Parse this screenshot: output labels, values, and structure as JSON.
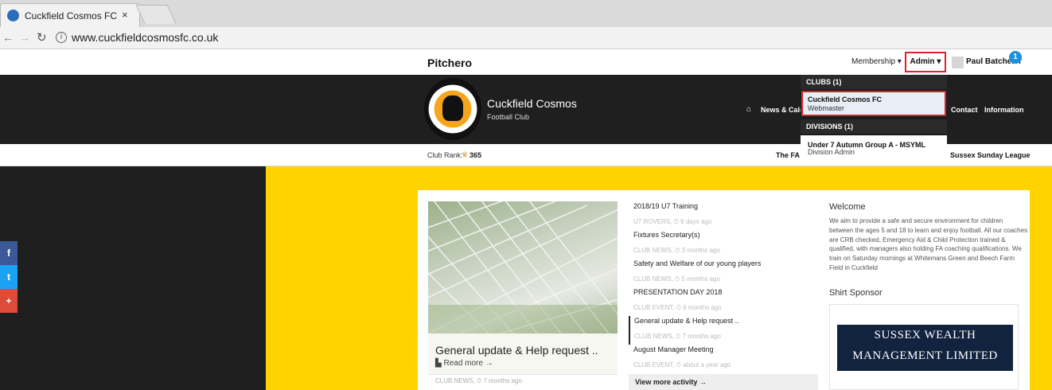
{
  "browser": {
    "tab_title": "Cuckfield Cosmos FC",
    "tab_close": "×",
    "url": "www.cuckfieldcosmosfc.co.uk"
  },
  "topbar": {
    "logo": "Pitchero",
    "membership": "Membership ▾",
    "admin": "Admin ▾",
    "user_name": "Paul Batchelor",
    "notification_count": "1"
  },
  "club": {
    "name": "Cuckfield Cosmos",
    "subtitle": "Football Club",
    "nav": {
      "news": "News & Cale",
      "contact": "Contact",
      "information": "Information"
    }
  },
  "rank_bar": {
    "label": "Club Rank:",
    "value": "365",
    "league_fa": "The FA",
    "league_sussex": "Sussex Sunday League"
  },
  "social": {
    "facebook": "f",
    "twitter": "t",
    "google": "+"
  },
  "featured": {
    "title": "General update & Help request ..",
    "read_more": "Read more →",
    "meta": "CLUB NEWS, ⏱ 7 months ago"
  },
  "activity": [
    {
      "title": "2018/19 U7 Training",
      "meta": "U7 ROVERS, ⏱ 9 days ago"
    },
    {
      "title": "Fixtures Secretary(s)",
      "meta": "CLUB NEWS, ⏱ 3 months ago"
    },
    {
      "title": "Safety and Welfare of our young players",
      "meta": "CLUB NEWS, ⏱ 5 months ago"
    },
    {
      "title": "PRESENTATION DAY 2018",
      "meta": "CLUB EVENT, ⏱ 6 months ago"
    },
    {
      "title": "General update & Help request ..",
      "meta": "CLUB NEWS, ⏱ 7 months ago"
    },
    {
      "title": "August Manager Meeting",
      "meta": "CLUB EVENT, ⏱ about a year ago"
    }
  ],
  "view_more": "View more activity →",
  "welcome": {
    "title": "Welcome",
    "body": "We aim to provide a safe and secure environment for children between the ages 5 and 18 to learn and enjoy football. All our coaches are CRB checked, Emergency Aid & Child Protection trained & qualified, with managers also holding FA coaching qualifications. We train on Saturday mornings at Whitemans Green and Beech Farm Field in Cuckfield",
    "sponsor_title": "Shirt Sponsor",
    "sponsor_line1": "SUSSEX WEALTH",
    "sponsor_line2": "MANAGEMENT LIMITED"
  },
  "admin_dropdown": {
    "clubs_header": "CLUBS (1)",
    "club_name": "Cuckfield Cosmos FC",
    "club_role": "Webmaster",
    "divisions_header": "DIVISIONS (1)",
    "division_name": "Under 7 Autumn Group A - MSYML",
    "division_role": "Division Admin"
  },
  "colors": {
    "accent_yellow": "#ffd300",
    "header_dark": "#1f1f1f",
    "highlight_red": "#e0202a",
    "badge_blue": "#1b8fe0"
  }
}
